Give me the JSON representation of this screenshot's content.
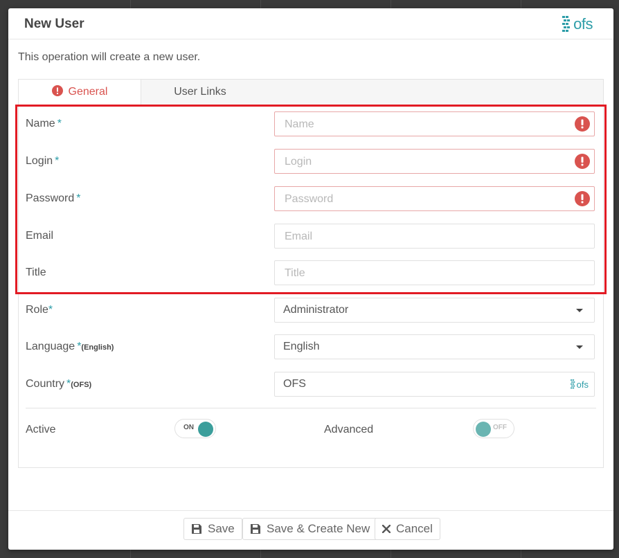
{
  "modal": {
    "title": "New User",
    "logo_text": "ofs",
    "intro": "This operation will create a new user."
  },
  "tabs": [
    {
      "label": "General",
      "active": true,
      "has_error": true
    },
    {
      "label": "User Links",
      "active": false
    }
  ],
  "form": {
    "name": {
      "label": "Name",
      "required": "*",
      "placeholder": "Name",
      "value": ""
    },
    "login": {
      "label": "Login",
      "required": "*",
      "placeholder": "Login",
      "value": ""
    },
    "password": {
      "label": "Password",
      "required": "*",
      "placeholder": "Password",
      "value": ""
    },
    "email": {
      "label": "Email",
      "placeholder": "Email",
      "value": ""
    },
    "title": {
      "label": "Title",
      "placeholder": "Title",
      "value": ""
    },
    "role": {
      "label": "Role",
      "required": "*",
      "value": "Administrator"
    },
    "language": {
      "label": "Language",
      "required": "*",
      "sub": "(English)",
      "value": "English"
    },
    "country": {
      "label": "Country",
      "required": "*",
      "sub": "(OFS)",
      "value": "OFS",
      "logo_text": "ofs"
    },
    "active": {
      "label": "Active",
      "state": "ON",
      "on": true
    },
    "advanced": {
      "label": "Advanced",
      "state": "OFF",
      "on": false
    }
  },
  "footer": {
    "save": "Save",
    "save_create_new": "Save & Create New",
    "cancel": "Cancel"
  },
  "colors": {
    "accent": "#2d9da8",
    "error": "#d9534f",
    "highlight": "#e21b24",
    "toggle": "#3b9e9b"
  }
}
